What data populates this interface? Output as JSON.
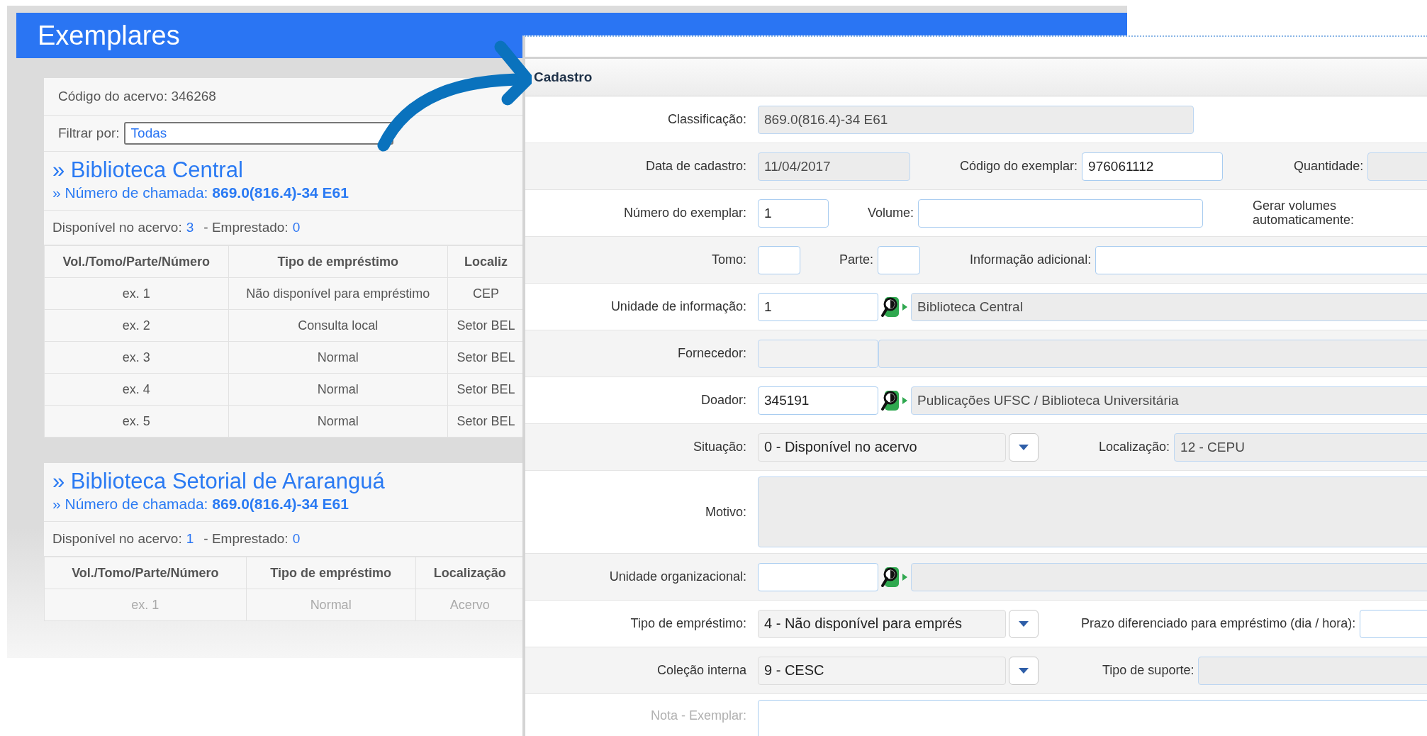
{
  "left_window": {
    "title": "Exemplares",
    "collection_code": "Código do acervo: 346268",
    "filter": {
      "label": "Filtrar por:",
      "value": "Todas"
    },
    "libraries": [
      {
        "name": "» Biblioteca Central",
        "call_number": "»  Número de chamada:  **869.0(816.4)-34 E61**",
        "available_label": "Disponível no acervo:",
        "available": "3",
        "loaned_label": "- Emprestado:",
        "loaned": "0",
        "table": {
          "columns": [
            "Vol./Tomo/Parte/Número",
            "Tipo de empréstimo",
            "Localiz"
          ],
          "rows": [
            [
              "ex. 1",
              "Não disponível para empréstimo",
              "CEP"
            ],
            [
              "ex. 2",
              "Consulta local",
              "Setor BEL"
            ],
            [
              "ex. 3",
              "Normal",
              "Setor BEL"
            ],
            [
              "ex. 4",
              "Normal",
              "Setor BEL"
            ],
            [
              "ex. 5",
              "Normal",
              "Setor BEL"
            ]
          ]
        }
      },
      {
        "name": "» Biblioteca Setorial de Araranguá",
        "call_number": "»  Número de chamada:  **869.0(816.4)-34 E61**",
        "available_label": "Disponível no acervo:",
        "available": "1",
        "loaned_label": "- Emprestado:",
        "loaned": "0",
        "table": {
          "columns": [
            "Vol./Tomo/Parte/Número",
            "Tipo de empréstimo",
            "Localização"
          ],
          "rows": [
            [
              "ex. 1",
              "Normal",
              "Acervo"
            ]
          ]
        }
      }
    ]
  },
  "form": {
    "title": "Cadastro",
    "rows": [
      {
        "fields": [
          {
            "label": "Classificação:",
            "kind": "readonly",
            "value": "869.0(816.4)-34 E61"
          }
        ]
      },
      {
        "fields": [
          {
            "label": "Data de cadastro:",
            "kind": "readonly",
            "value": "11/04/2017"
          },
          {
            "label": "Código do exemplar:",
            "kind": "text",
            "value": "976061112"
          },
          {
            "label": "Quantidade:",
            "kind": "readonly"
          }
        ]
      },
      {
        "fields": [
          {
            "label": "Número do exemplar:",
            "kind": "text",
            "value": "1"
          },
          {
            "label": "Volume:",
            "kind": "text"
          },
          {
            "label": "Gerar volumes automaticamente:",
            "kind": "label"
          }
        ]
      },
      {
        "fields": [
          {
            "label": "Tomo:",
            "kind": "text"
          },
          {
            "label": "Parte:",
            "kind": "text"
          },
          {
            "label": "Informação adicional:",
            "kind": "text"
          }
        ]
      },
      {
        "fields": [
          {
            "label": "Unidade de informação:",
            "kind": "lookup",
            "value": "1",
            "name": "Biblioteca Central"
          }
        ]
      },
      {
        "fields": [
          {
            "label": "Fornecedor:",
            "kind": "pair"
          }
        ]
      },
      {
        "fields": [
          {
            "label": "Doador:",
            "kind": "lookup",
            "value": "345191",
            "name": "Publicações UFSC / Biblioteca Universitária"
          }
        ]
      },
      {
        "fields": [
          {
            "label": "Situação:",
            "kind": "select",
            "value": "0 - Disponível no acervo"
          },
          {
            "label": "Localização:",
            "kind": "readonly",
            "value": "12 - CEPU"
          }
        ]
      },
      {
        "fields": [
          {
            "label": "Motivo:",
            "kind": "textarea-readonly"
          }
        ]
      },
      {
        "fields": [
          {
            "label": "Unidade organizacional:",
            "kind": "lookup"
          }
        ]
      },
      {
        "fields": [
          {
            "label": "Tipo de empréstimo:",
            "kind": "select",
            "value": "4 - Não disponível para emprés"
          },
          {
            "label": "Prazo diferenciado para empréstimo (dia / hora):",
            "kind": "text"
          }
        ]
      },
      {
        "fields": [
          {
            "label": "Coleção interna",
            "kind": "select",
            "value": "9 - CESC"
          },
          {
            "label": "Tipo de suporte:",
            "kind": "readonly"
          }
        ]
      },
      {
        "fields": [
          {
            "label": "Nota - Exemplar:",
            "kind": "textarea"
          }
        ]
      }
    ]
  }
}
